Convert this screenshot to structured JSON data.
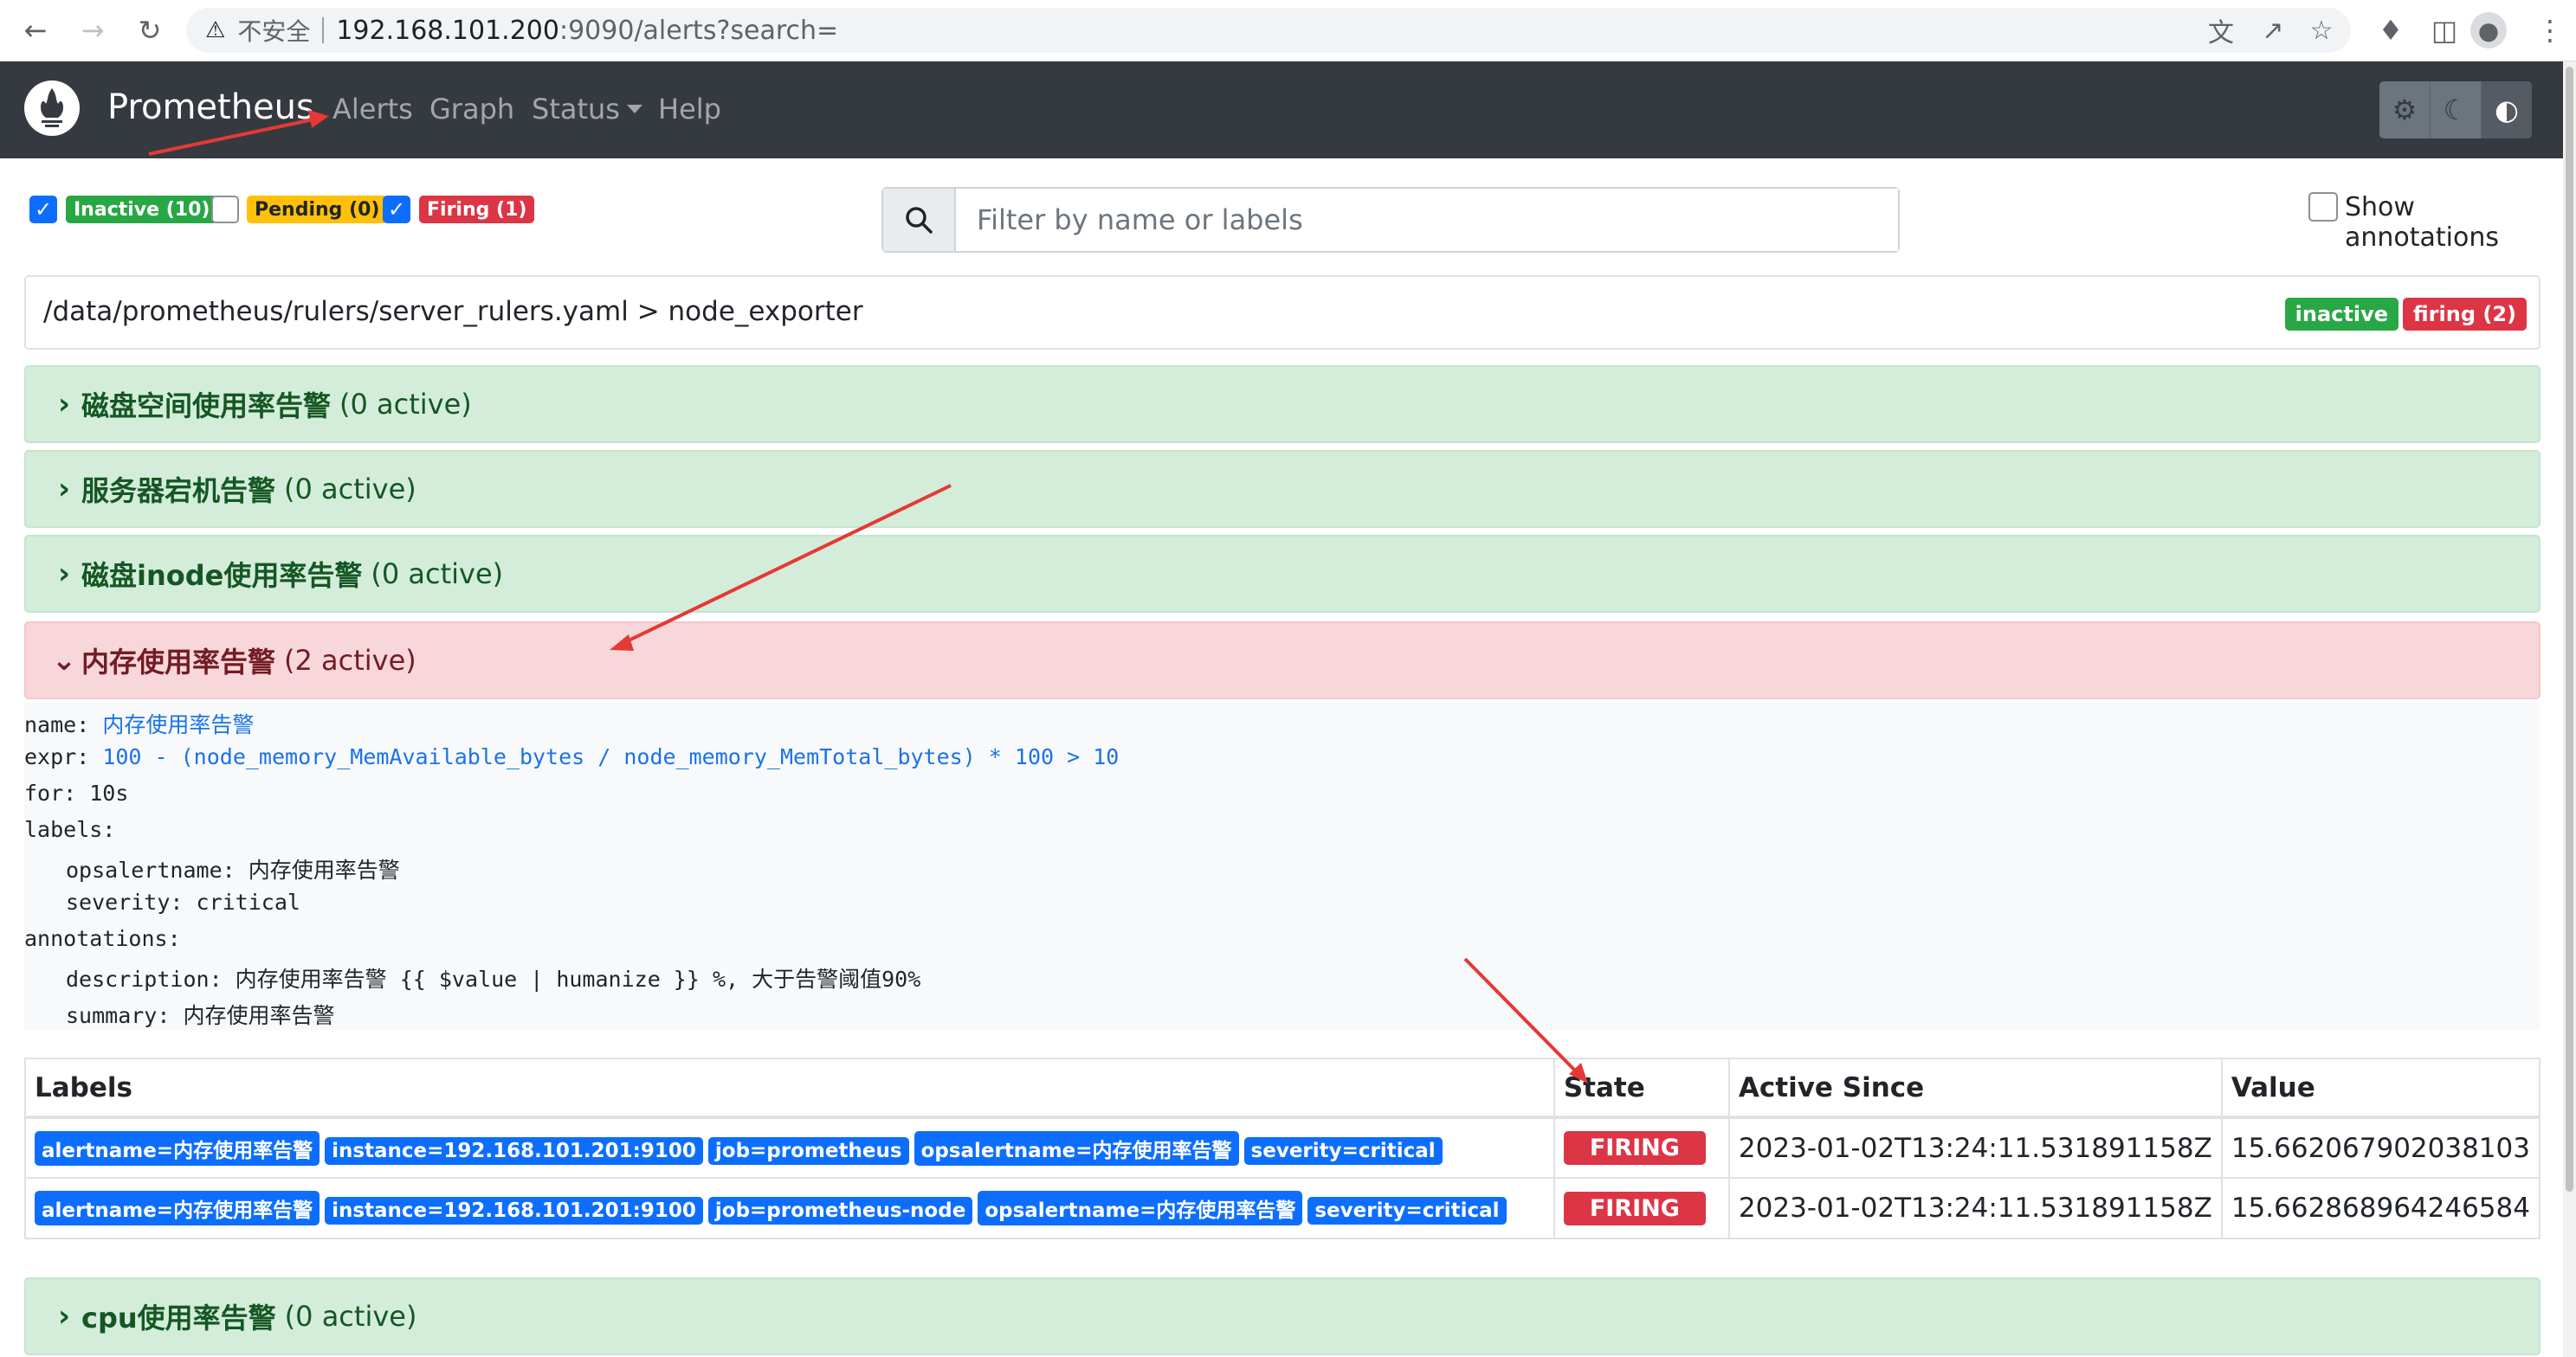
{
  "browser": {
    "insecure_label": "不安全",
    "url_host": "192.168.101.200",
    "url_rest": ":9090/alerts?search="
  },
  "navbar": {
    "brand": "Prometheus",
    "links": [
      "Alerts",
      "Graph",
      "Status",
      "Help"
    ]
  },
  "filters": {
    "inactive": "Inactive (10)",
    "pending": "Pending (0)",
    "firing": "Firing (1)",
    "inactive_checked": true,
    "pending_checked": false,
    "firing_checked": true
  },
  "search": {
    "placeholder": "Filter by name or labels"
  },
  "show_annotations": "Show annotations",
  "rule_file": {
    "path": "/data/prometheus/rulers/server_rulers.yaml > node_exporter",
    "badge_inactive": "inactive",
    "badge_firing": "firing (2)"
  },
  "rules": [
    {
      "name": "磁盘空间使用率告警",
      "count": "(0 active)",
      "state": "inactive",
      "expanded": false
    },
    {
      "name": "服务器宕机告警",
      "count": "(0 active)",
      "state": "inactive",
      "expanded": false
    },
    {
      "name": "磁盘inode使用率告警",
      "count": "(0 active)",
      "state": "inactive",
      "expanded": false
    },
    {
      "name": "内存使用率告警",
      "count": "(2 active)",
      "state": "firing",
      "expanded": true
    },
    {
      "name": "cpu使用率告警",
      "count": "(0 active)",
      "state": "inactive",
      "expanded": false
    }
  ],
  "rule_detail": {
    "name_key": "name: ",
    "name_val": "内存使用率告警",
    "expr_key": "expr: ",
    "expr_val": "100 - (node_memory_MemAvailable_bytes / node_memory_MemTotal_bytes) * 100 > 10",
    "for_line": "for: 10s",
    "labels_key": "labels:",
    "label_1": "opsalertname: 内存使用率告警",
    "label_2": "severity: critical",
    "annotations_key": "annotations:",
    "annotation_1": "description: 内存使用率告警 {{ $value | humanize }} %, 大于告警阈值90%",
    "annotation_2": "summary: 内存使用率告警"
  },
  "table": {
    "headers": [
      "Labels",
      "State",
      "Active Since",
      "Value"
    ],
    "rows": [
      {
        "labels": [
          "alertname=内存使用率告警",
          "instance=192.168.101.201:9100",
          "job=prometheus",
          "opsalertname=内存使用率告警",
          "severity=critical"
        ],
        "state": "FIRING",
        "active_since": "2023-01-02T13:24:11.531891158Z",
        "value": "15.662067902038103"
      },
      {
        "labels": [
          "alertname=内存使用率告警",
          "instance=192.168.101.201:9100",
          "job=prometheus-node",
          "opsalertname=内存使用率告警",
          "severity=critical"
        ],
        "state": "FIRING",
        "active_since": "2023-01-02T13:24:11.531891158Z",
        "value": "15.662868964246584"
      }
    ]
  },
  "colors": {
    "navbar": "#343a40",
    "inactive_bg": "#d4edda",
    "firing_bg": "#f8d7da",
    "label_badge": "#0d6efd",
    "firing_badge": "#dc3545",
    "annotation_arrow": "#e53935"
  }
}
